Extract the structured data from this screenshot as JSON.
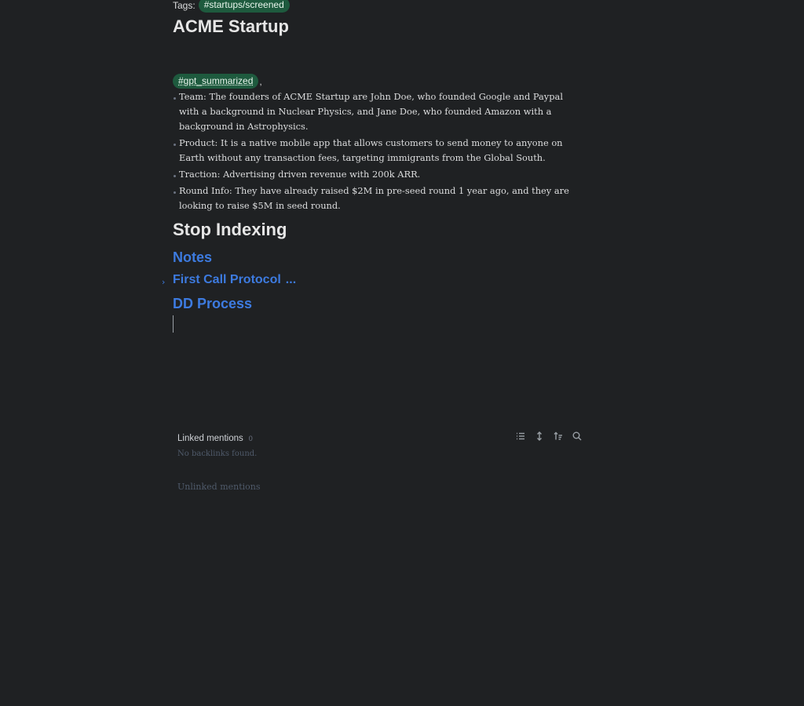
{
  "frontmatter": {
    "tags_label": "Tags:",
    "tag": "#startups/screened"
  },
  "note": {
    "title": "ACME Startup",
    "gpt_tag": "#gpt_summarized",
    "gpt_suffix": ",",
    "bullets": [
      "Team:  The founders of ACME Startup are John Doe, who founded Google and Paypal with a background in Nuclear Physics, and Jane Doe, who founded Amazon with a background in Astrophysics.",
      "Product: It is a native mobile app that allows customers to send money to anyone on Earth without any transaction fees, targeting immigrants from the Global South.",
      "Traction: Advertising driven revenue with 200k ARR.",
      "Round Info: They have already raised $2M in pre-seed round 1 year ago, and they are looking to raise $5M in seed round."
    ],
    "heading_stop": "Stop Indexing",
    "heading_notes": "Notes",
    "heading_first_call": "First Call Protocol",
    "first_call_ellipsis": "...",
    "heading_dd": "DD Process"
  },
  "backlinks": {
    "title": "Linked mentions",
    "count": "0",
    "empty": "No backlinks found.",
    "unlinked": "Unlinked mentions",
    "icons": [
      "list-icon",
      "expand-icon",
      "sort-icon",
      "search-icon"
    ]
  },
  "colors": {
    "background": "#1f2123",
    "tag_bg": "#1e5a3e",
    "link": "#3d7be0"
  }
}
